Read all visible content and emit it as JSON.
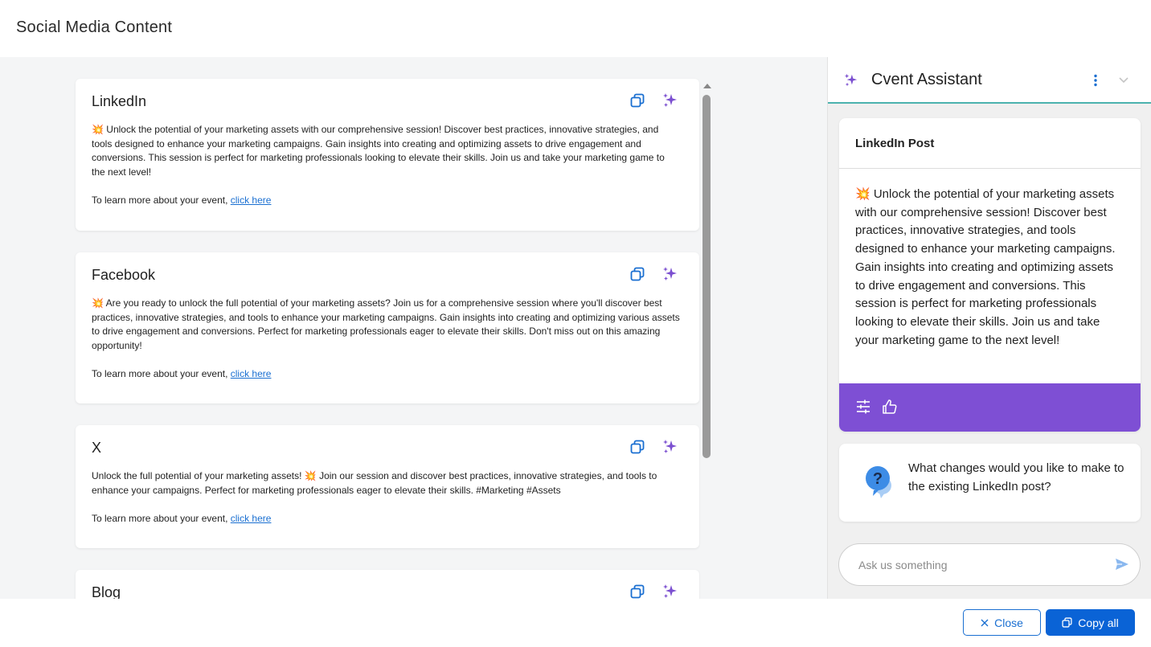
{
  "page": {
    "title": "Social Media Content"
  },
  "cards": [
    {
      "title": "LinkedIn",
      "body": "💥 Unlock the potential of your marketing assets with our comprehensive session! Discover best practices, innovative strategies, and tools designed to enhance your marketing campaigns. Gain insights into creating and optimizing assets to drive engagement and conversions. This session is perfect for marketing professionals looking to elevate their skills. Join us and take your marketing game to the next level!",
      "footer_text": "To learn more about your event, ",
      "link_text": "click here"
    },
    {
      "title": "Facebook",
      "body": "💥 Are you ready to unlock the full potential of your marketing assets? Join us for a comprehensive session where you'll discover best practices, innovative strategies, and tools to enhance your marketing campaigns. Gain insights into creating and optimizing various assets to drive engagement and conversions. Perfect for marketing professionals eager to elevate their skills. Don't miss out on this amazing opportunity!",
      "footer_text": "To learn more about your event, ",
      "link_text": "click here"
    },
    {
      "title": "X",
      "body": "Unlock the full potential of your marketing assets! 💥 Join our session and discover best practices, innovative strategies, and tools to enhance your campaigns. Perfect for marketing professionals eager to elevate their skills. #Marketing #Assets",
      "footer_text": "To learn more about your event, ",
      "link_text": "click here"
    },
    {
      "title": "Blog"
    }
  ],
  "icons": {
    "copy": "copy-icon",
    "ai": "sparkle-icon",
    "menu": "kebab-menu-icon",
    "collapse": "chevron-down-icon",
    "adjust": "sliders-icon",
    "like": "thumbs-up-icon",
    "question": "question-bubble-icon",
    "send": "send-icon",
    "close": "close-icon"
  },
  "assistant": {
    "title": "Cvent Assistant",
    "message": {
      "heading": "LinkedIn Post",
      "body": "💥 Unlock the potential of your marketing assets with our comprehensive session! Discover best practices, innovative strategies, and tools designed to enhance your marketing campaigns. Gain insights into creating and optimizing assets to drive engagement and conversions. This session is perfect for marketing professionals looking to elevate their skills. Join us and take your marketing game to the next level!"
    },
    "question": "What changes would you like to make to the existing LinkedIn post?",
    "input_placeholder": "Ask us something"
  },
  "footer": {
    "close_label": "Close",
    "copy_all_label": "Copy all"
  },
  "colors": {
    "accent_blue": "#0a63d6",
    "assistant_purple": "#7e4fd4",
    "assistant_border": "#4bb2ae",
    "sparkle": "#7b4fd0"
  }
}
